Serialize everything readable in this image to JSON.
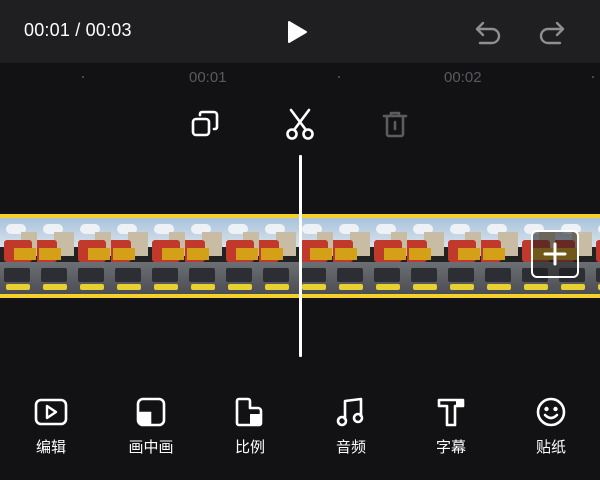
{
  "player": {
    "timecode": "00:01 / 00:03",
    "play_icon": "play-icon",
    "undo_icon": "undo-icon",
    "redo_icon": "redo-icon"
  },
  "ruler": {
    "labels": [
      "00:01",
      "00:02"
    ]
  },
  "actions": [
    {
      "name": "copy",
      "icon": "copy-icon"
    },
    {
      "name": "split",
      "icon": "scissors-icon"
    },
    {
      "name": "delete",
      "icon": "trash-icon"
    }
  ],
  "timeline": {
    "accent_color": "#f5d22b",
    "add_icon": "plus-icon"
  },
  "toolbar": {
    "items": [
      {
        "label": "编辑",
        "icon": "edit-video-icon"
      },
      {
        "label": "画中画",
        "icon": "picture-in-picture-icon"
      },
      {
        "label": "比例",
        "icon": "aspect-ratio-icon"
      },
      {
        "label": "音频",
        "icon": "music-note-icon"
      },
      {
        "label": "字幕",
        "icon": "text-icon"
      },
      {
        "label": "贴纸",
        "icon": "sticker-icon"
      }
    ]
  }
}
